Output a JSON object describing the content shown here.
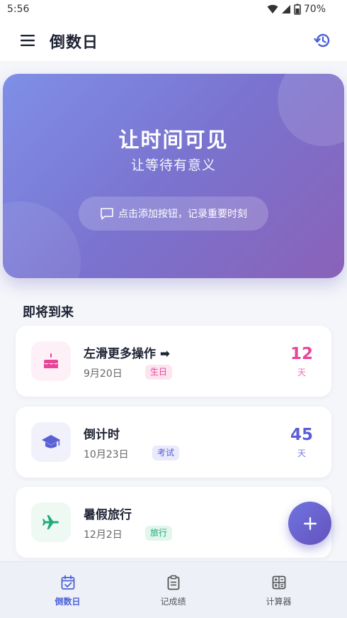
{
  "status": {
    "time": "5:56",
    "battery": "70%"
  },
  "app_bar": {
    "title": "倒数日",
    "menu_icon": "menu-icon",
    "history_icon": "history-icon"
  },
  "hero": {
    "title": "让时间可见",
    "subtitle": "让等待有意义",
    "hint": "点击添加按钮，记录重要时刻",
    "gradient": [
      "#7f8fe7",
      "#8a62b8"
    ]
  },
  "section": {
    "title": "即将到来"
  },
  "events": [
    {
      "title": "左滑更多操作 ➡",
      "date": "9月20日",
      "badge": "生日",
      "count": "12",
      "unit": "天",
      "icon": "cake-icon",
      "accent": "#e8449a"
    },
    {
      "title": "倒计时",
      "date": "10月23日",
      "badge": "考试",
      "count": "45",
      "unit": "天",
      "icon": "graduation-cap-icon",
      "accent": "#5b5fd6"
    },
    {
      "title": "暑假旅行",
      "date": "12月2日",
      "badge": "旅行",
      "count": "",
      "unit": "",
      "icon": "airplane-icon",
      "accent": "#23a97a"
    }
  ],
  "fab": {
    "icon": "plus-icon"
  },
  "nav": [
    {
      "label": "倒数日",
      "icon": "calendar-check-icon",
      "active": true
    },
    {
      "label": "记成绩",
      "icon": "clipboard-icon",
      "active": false
    },
    {
      "label": "计算器",
      "icon": "calculator-icon",
      "active": false
    }
  ],
  "colors": {
    "primary": "#4a61d8",
    "background": "#f4f6fa"
  }
}
